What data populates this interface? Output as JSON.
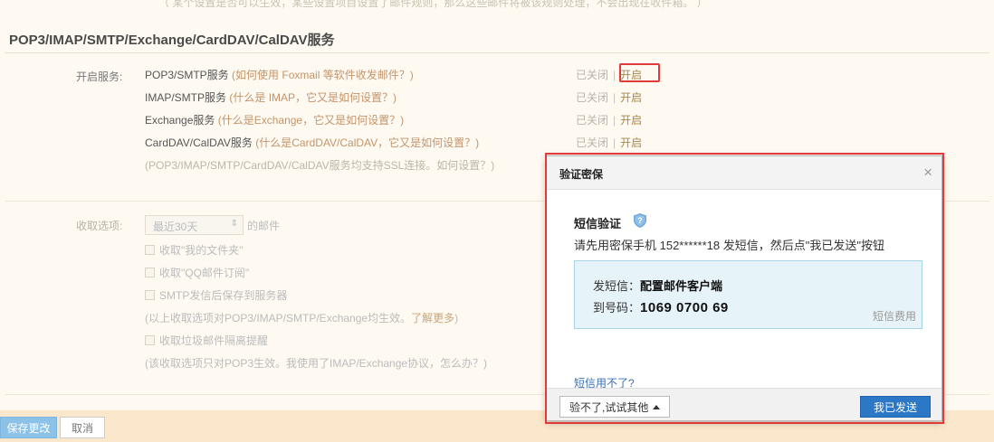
{
  "background": {
    "top_fragment": "（ 某个设置是否可以生效，某些设置项目设置了邮件规则，那么这些邮件将被该规则处理，不会出现在收件箱。 ）",
    "section_title": "POP3/IMAP/SMTP/Exchange/CardDAV/CalDAV服务",
    "open_service_label": "开启服务:",
    "services": [
      {
        "name": "POP3/SMTP服务",
        "hint": "(如何使用 Foxmail 等软件收发邮件？)",
        "closed": "已关闭",
        "sep": "|",
        "open": "开启"
      },
      {
        "name": "IMAP/SMTP服务",
        "hint": "(什么是 IMAP，它又是如何设置？)",
        "closed": "已关闭",
        "sep": "|",
        "open": "开启"
      },
      {
        "name": "Exchange服务",
        "hint": "(什么是Exchange，它又是如何设置？)",
        "closed": "已关闭",
        "sep": "|",
        "open": "开启"
      },
      {
        "name": "CardDAV/CalDAV服务",
        "hint": "(什么是CardDAV/CalDAV，它又是如何设置？)",
        "closed": "已关闭",
        "sep": "|",
        "open": "开启"
      }
    ],
    "ssl_note": "(POP3/IMAP/SMTP/CardDAV/CalDAV服务均支持SSL连接。如何设置？)",
    "receive_label": "收取选项:",
    "receive_select": "最近30天",
    "receive_suffix": "的邮件",
    "options": [
      "收取\"我的文件夹\"",
      "收取\"QQ邮件订阅\"",
      "SMTP发信后保存到服务器"
    ],
    "note1_text": "(以上收取选项对POP3/IMAP/SMTP/Exchange均生效。",
    "note1_link": "了解更多",
    "note1_end": ")",
    "option_junk": "收取垃圾邮件隔离提醒",
    "note2": "(该收取选项只对POP3生效。我使用了IMAP/Exchange协议，怎么办？)",
    "save_button": "保存更改",
    "cancel_button": "取消"
  },
  "dialog": {
    "title": "验证密保",
    "close": "×",
    "sms_title": "短信验证",
    "description": "请先用密保手机 152******18 发短信，然后点\"我已发送\"按钮",
    "send_label": "发短信：",
    "send_content": "配置邮件客户端",
    "to_label": "到号码：",
    "to_number": "1069 0700 69",
    "fee_note": "短信费用",
    "sms_unavailable": "短信用不了?",
    "other_button": "验不了,试试其他",
    "sent_button": "我已发送"
  },
  "colors": {
    "highlight_red": "#e03a3a",
    "primary_blue": "#2d78c6",
    "info_box_bg": "#e6f3f8"
  }
}
